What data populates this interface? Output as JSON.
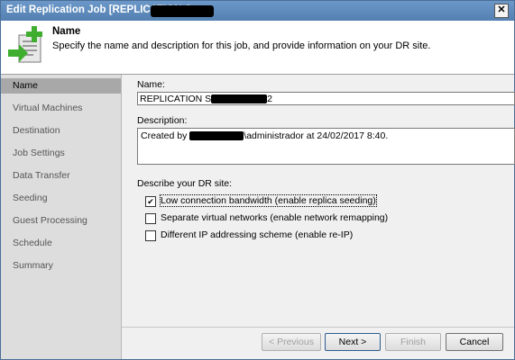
{
  "window": {
    "title": "Edit Replication Job [REPLICATION S"
  },
  "header": {
    "title": "Name",
    "description": "Specify the name and description for this job, and provide information on your DR site."
  },
  "sidebar": {
    "items": [
      {
        "label": "Name",
        "active": true
      },
      {
        "label": "Virtual Machines"
      },
      {
        "label": "Destination"
      },
      {
        "label": "Job Settings"
      },
      {
        "label": "Data Transfer"
      },
      {
        "label": "Seeding"
      },
      {
        "label": "Guest Processing"
      },
      {
        "label": "Schedule"
      },
      {
        "label": "Summary"
      }
    ]
  },
  "form": {
    "name_label": "Name:",
    "name_value": "REPLICATION S",
    "name_value_tail": "2",
    "description_label": "Description:",
    "description_prefix": "Created by",
    "description_suffix": "\\administrador at 24/02/2017 8:40.",
    "dr_site_label": "Describe your DR site:",
    "options": [
      {
        "label": "Low connection bandwidth (enable replica seeding)",
        "checked": true
      },
      {
        "label": "Separate virtual networks (enable network remapping)",
        "checked": false
      },
      {
        "label": "Different IP addressing scheme (enable re-IP)",
        "checked": false
      }
    ]
  },
  "buttons": {
    "previous": "< Previous",
    "next": "Next >",
    "finish": "Finish",
    "cancel": "Cancel"
  },
  "icons": {
    "close": "close-icon",
    "header": "replication-job-icon",
    "check": "checkmark-icon"
  },
  "colors": {
    "titlebar": "#5e8cbd",
    "sidebar_active": "#a8a8a8",
    "icon_green": "#3fae2f"
  }
}
